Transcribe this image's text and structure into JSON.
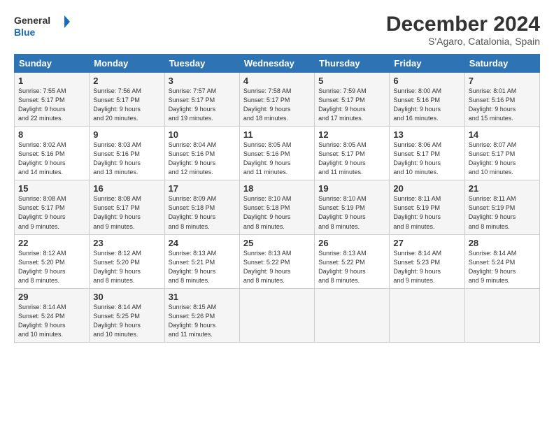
{
  "logo": {
    "line1": "General",
    "line2": "Blue"
  },
  "title": "December 2024",
  "subtitle": "S'Agaro, Catalonia, Spain",
  "days_header": [
    "Sunday",
    "Monday",
    "Tuesday",
    "Wednesday",
    "Thursday",
    "Friday",
    "Saturday"
  ],
  "weeks": [
    [
      {
        "day": "1",
        "info": "Sunrise: 7:55 AM\nSunset: 5:17 PM\nDaylight: 9 hours\nand 22 minutes."
      },
      {
        "day": "2",
        "info": "Sunrise: 7:56 AM\nSunset: 5:17 PM\nDaylight: 9 hours\nand 20 minutes."
      },
      {
        "day": "3",
        "info": "Sunrise: 7:57 AM\nSunset: 5:17 PM\nDaylight: 9 hours\nand 19 minutes."
      },
      {
        "day": "4",
        "info": "Sunrise: 7:58 AM\nSunset: 5:17 PM\nDaylight: 9 hours\nand 18 minutes."
      },
      {
        "day": "5",
        "info": "Sunrise: 7:59 AM\nSunset: 5:17 PM\nDaylight: 9 hours\nand 17 minutes."
      },
      {
        "day": "6",
        "info": "Sunrise: 8:00 AM\nSunset: 5:16 PM\nDaylight: 9 hours\nand 16 minutes."
      },
      {
        "day": "7",
        "info": "Sunrise: 8:01 AM\nSunset: 5:16 PM\nDaylight: 9 hours\nand 15 minutes."
      }
    ],
    [
      {
        "day": "8",
        "info": "Sunrise: 8:02 AM\nSunset: 5:16 PM\nDaylight: 9 hours\nand 14 minutes."
      },
      {
        "day": "9",
        "info": "Sunrise: 8:03 AM\nSunset: 5:16 PM\nDaylight: 9 hours\nand 13 minutes."
      },
      {
        "day": "10",
        "info": "Sunrise: 8:04 AM\nSunset: 5:16 PM\nDaylight: 9 hours\nand 12 minutes."
      },
      {
        "day": "11",
        "info": "Sunrise: 8:05 AM\nSunset: 5:16 PM\nDaylight: 9 hours\nand 11 minutes."
      },
      {
        "day": "12",
        "info": "Sunrise: 8:05 AM\nSunset: 5:17 PM\nDaylight: 9 hours\nand 11 minutes."
      },
      {
        "day": "13",
        "info": "Sunrise: 8:06 AM\nSunset: 5:17 PM\nDaylight: 9 hours\nand 10 minutes."
      },
      {
        "day": "14",
        "info": "Sunrise: 8:07 AM\nSunset: 5:17 PM\nDaylight: 9 hours\nand 10 minutes."
      }
    ],
    [
      {
        "day": "15",
        "info": "Sunrise: 8:08 AM\nSunset: 5:17 PM\nDaylight: 9 hours\nand 9 minutes."
      },
      {
        "day": "16",
        "info": "Sunrise: 8:08 AM\nSunset: 5:17 PM\nDaylight: 9 hours\nand 9 minutes."
      },
      {
        "day": "17",
        "info": "Sunrise: 8:09 AM\nSunset: 5:18 PM\nDaylight: 9 hours\nand 8 minutes."
      },
      {
        "day": "18",
        "info": "Sunrise: 8:10 AM\nSunset: 5:18 PM\nDaylight: 9 hours\nand 8 minutes."
      },
      {
        "day": "19",
        "info": "Sunrise: 8:10 AM\nSunset: 5:19 PM\nDaylight: 9 hours\nand 8 minutes."
      },
      {
        "day": "20",
        "info": "Sunrise: 8:11 AM\nSunset: 5:19 PM\nDaylight: 9 hours\nand 8 minutes."
      },
      {
        "day": "21",
        "info": "Sunrise: 8:11 AM\nSunset: 5:19 PM\nDaylight: 9 hours\nand 8 minutes."
      }
    ],
    [
      {
        "day": "22",
        "info": "Sunrise: 8:12 AM\nSunset: 5:20 PM\nDaylight: 9 hours\nand 8 minutes."
      },
      {
        "day": "23",
        "info": "Sunrise: 8:12 AM\nSunset: 5:20 PM\nDaylight: 9 hours\nand 8 minutes."
      },
      {
        "day": "24",
        "info": "Sunrise: 8:13 AM\nSunset: 5:21 PM\nDaylight: 9 hours\nand 8 minutes."
      },
      {
        "day": "25",
        "info": "Sunrise: 8:13 AM\nSunset: 5:22 PM\nDaylight: 9 hours\nand 8 minutes."
      },
      {
        "day": "26",
        "info": "Sunrise: 8:13 AM\nSunset: 5:22 PM\nDaylight: 9 hours\nand 8 minutes."
      },
      {
        "day": "27",
        "info": "Sunrise: 8:14 AM\nSunset: 5:23 PM\nDaylight: 9 hours\nand 9 minutes."
      },
      {
        "day": "28",
        "info": "Sunrise: 8:14 AM\nSunset: 5:24 PM\nDaylight: 9 hours\nand 9 minutes."
      }
    ],
    [
      {
        "day": "29",
        "info": "Sunrise: 8:14 AM\nSunset: 5:24 PM\nDaylight: 9 hours\nand 10 minutes."
      },
      {
        "day": "30",
        "info": "Sunrise: 8:14 AM\nSunset: 5:25 PM\nDaylight: 9 hours\nand 10 minutes."
      },
      {
        "day": "31",
        "info": "Sunrise: 8:15 AM\nSunset: 5:26 PM\nDaylight: 9 hours\nand 11 minutes."
      },
      null,
      null,
      null,
      null
    ]
  ]
}
